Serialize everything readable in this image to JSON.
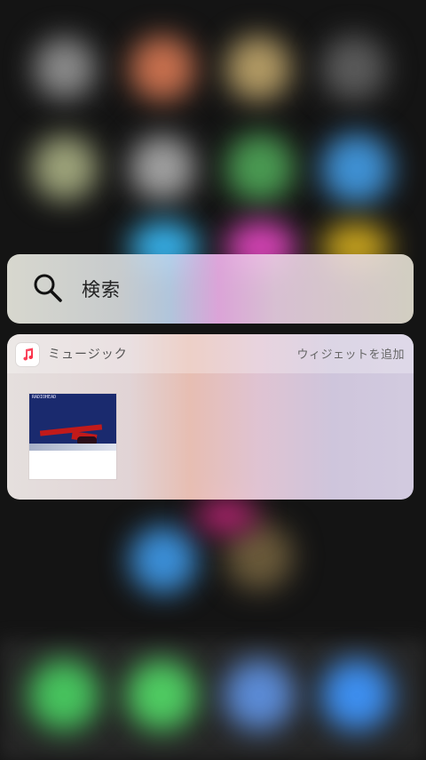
{
  "search": {
    "label": "検索",
    "icon": "search-icon"
  },
  "widget": {
    "app_name": "ミュージック",
    "app_icon": "music-note-icon",
    "add_widget_label": "ウィジェットを追加",
    "album_art_caption": "RADIOHEAD"
  },
  "background": {
    "description_colors": [
      "#7d7d7d",
      "#c96f4b",
      "#b59a63",
      "#5b5b5b",
      "#9fa47a",
      "#a0a0a0",
      "#4c9a55",
      "#3f8fd0",
      "#3cb2ec",
      "#d63fb6",
      "#c8a31c",
      "#55d16a",
      "#6b8fcf",
      "#3f8ef0"
    ]
  }
}
